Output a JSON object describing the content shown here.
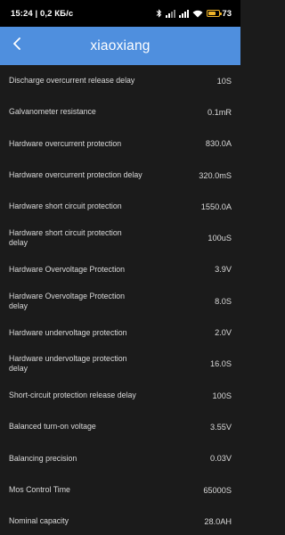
{
  "status_bar": {
    "time_speed": "15:24 | 0,2 КБ/с",
    "battery_percent": "73",
    "battery_level": 0.73,
    "accent_color": "#f0b429"
  },
  "header": {
    "title": "xiaoxiang",
    "back_icon": "chevron-left-icon",
    "background": "#4f8fde"
  },
  "params": [
    {
      "label": "Discharge overcurrent release delay",
      "value": "10S"
    },
    {
      "label": "Galvanometer resistance",
      "value": "0.1mR"
    },
    {
      "label": "Hardware overcurrent protection",
      "value": "830.0A"
    },
    {
      "label": "Hardware overcurrent protection delay",
      "value": "320.0mS"
    },
    {
      "label": "Hardware short circuit protection",
      "value": "1550.0A"
    },
    {
      "label": "Hardware short circuit protection delay",
      "value": "100uS"
    },
    {
      "label": "Hardware Overvoltage Protection",
      "value": "3.9V"
    },
    {
      "label": "Hardware Overvoltage Protection delay",
      "value": "8.0S"
    },
    {
      "label": "Hardware undervoltage protection",
      "value": "2.0V"
    },
    {
      "label": "Hardware undervoltage protection delay",
      "value": "16.0S"
    },
    {
      "label": "Short-circuit protection release delay",
      "value": "100S"
    },
    {
      "label": "Balanced turn-on voltage",
      "value": "3.55V"
    },
    {
      "label": "Balancing precision",
      "value": "0.03V"
    },
    {
      "label": "Mos Control Time",
      "value": "65000S"
    },
    {
      "label": "Nominal capacity",
      "value": "28.0AH"
    }
  ]
}
